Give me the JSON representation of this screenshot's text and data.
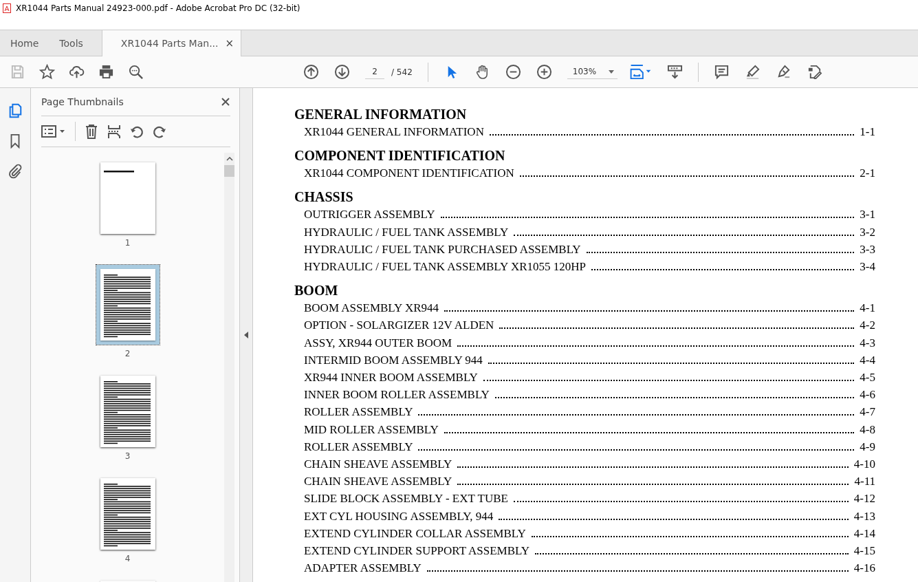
{
  "window": {
    "title": "XR1044 Parts Manual 24923-000.pdf - Adobe Acrobat Pro DC (32-bit)"
  },
  "tabs": [
    {
      "label": "Home",
      "selected": false,
      "closable": false
    },
    {
      "label": "Tools",
      "selected": false,
      "closable": false
    },
    {
      "label": "XR1044 Parts Man...",
      "selected": true,
      "closable": true
    }
  ],
  "close_glyph": "×",
  "toolbar": {
    "page": "2",
    "page_total": "/ 542",
    "zoom": "103%"
  },
  "side_panel": {
    "title": "Page Thumbnails",
    "thumbnails": [
      {
        "label": "1",
        "selected": false,
        "kind": "title"
      },
      {
        "label": "2",
        "selected": true,
        "kind": "text"
      },
      {
        "label": "3",
        "selected": false,
        "kind": "text"
      },
      {
        "label": "4",
        "selected": false,
        "kind": "text"
      }
    ]
  },
  "document": {
    "sections": [
      {
        "title": "GENERAL INFORMATION",
        "entries": [
          {
            "name": "XR1044 GENERAL INFORMATION",
            "page": "1-1"
          }
        ]
      },
      {
        "title": "COMPONENT IDENTIFICATION",
        "entries": [
          {
            "name": "XR1044 COMPONENT IDENTIFICATION",
            "page": "2-1"
          }
        ]
      },
      {
        "title": "CHASSIS",
        "entries": [
          {
            "name": "OUTRIGGER ASSEMBLY",
            "page": "3-1"
          },
          {
            "name": "HYDRAULIC / FUEL TANK ASSEMBLY",
            "page": "3-2"
          },
          {
            "name": "HYDRAULIC / FUEL TANK PURCHASED ASSEMBLY",
            "page": "3-3"
          },
          {
            "name": "HYDRAULIC / FUEL TANK ASSEMBLY XR1055 120HP",
            "page": "3-4"
          }
        ]
      },
      {
        "title": "BOOM",
        "entries": [
          {
            "name": "BOOM ASSEMBLY XR944",
            "page": "4-1"
          },
          {
            "name": "OPTION - SOLARGIZER 12V ALDEN",
            "page": "4-2"
          },
          {
            "name": "ASSY, XR944 OUTER BOOM",
            "page": "4-3"
          },
          {
            "name": "INTERMID BOOM ASSEMBLY 944",
            "page": "4-4"
          },
          {
            "name": "XR944 INNER BOOM ASSEMBLY",
            "page": "4-5"
          },
          {
            "name": "INNER BOOM ROLLER ASSEMBLY",
            "page": "4-6"
          },
          {
            "name": "ROLLER ASSEMBLY",
            "page": "4-7"
          },
          {
            "name": "MID ROLLER ASSEMBLY",
            "page": "4-8"
          },
          {
            "name": "ROLLER ASSEMBLY",
            "page": "4-9"
          },
          {
            "name": "CHAIN SHEAVE ASSEMBLY",
            "page": "4-10"
          },
          {
            "name": "CHAIN SHEAVE ASSEMBLY",
            "page": "4-11"
          },
          {
            "name": "SLIDE BLOCK ASSEMBLY - EXT TUBE",
            "page": "4-12"
          },
          {
            "name": "EXT CYL HOUSING ASSEMBLY, 944",
            "page": "4-13"
          },
          {
            "name": "EXTEND CYLINDER COLLAR ASSEMBLY",
            "page": "4-14"
          },
          {
            "name": "EXTEND CYLINDER SUPPORT ASSEMBLY",
            "page": "4-15"
          },
          {
            "name": "ADAPTER ASSEMBLY",
            "page": "4-16"
          }
        ]
      }
    ]
  }
}
